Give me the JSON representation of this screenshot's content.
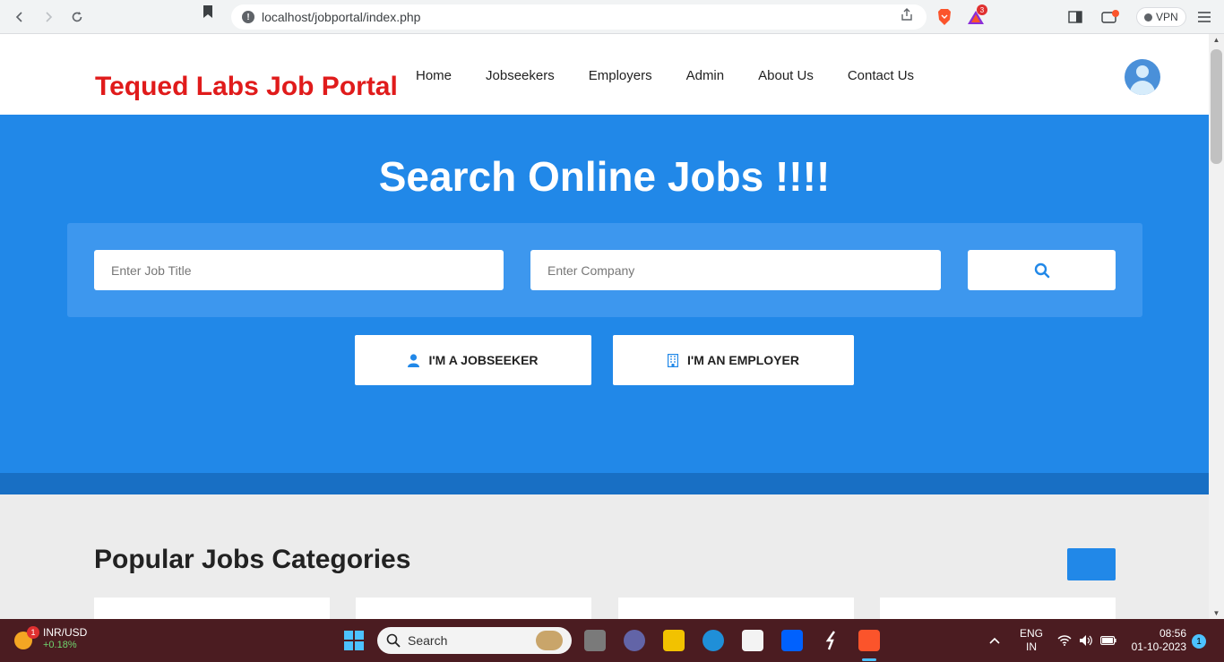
{
  "browser": {
    "url": "localhost/jobportal/index.php",
    "vpn_label": "VPN",
    "brave_rewards_count": "3"
  },
  "site": {
    "logo": "Tequed Labs Job Portal",
    "nav": [
      "Home",
      "Jobseekers",
      "Employers",
      "Admin",
      "About Us",
      "Contact Us"
    ],
    "accent_color": "#2188e8",
    "logo_color": "#e01b1b"
  },
  "hero": {
    "title": "Search Online Jobs !!!!",
    "job_title_placeholder": "Enter Job Title",
    "company_placeholder": "Enter Company",
    "search_icon": "search-icon",
    "jobseeker_label": "I'M A JOBSEEKER",
    "employer_label": "I'M AN EMPLOYER"
  },
  "section": {
    "title": "Popular Jobs Categories"
  },
  "taskbar": {
    "stock_name": "INR/USD",
    "stock_change": "+0.18%",
    "stock_badge": "1",
    "search_label": "Search",
    "lang_line1": "ENG",
    "lang_line2": "IN",
    "time": "08:56",
    "date": "01-10-2023",
    "notification_count": "1"
  }
}
